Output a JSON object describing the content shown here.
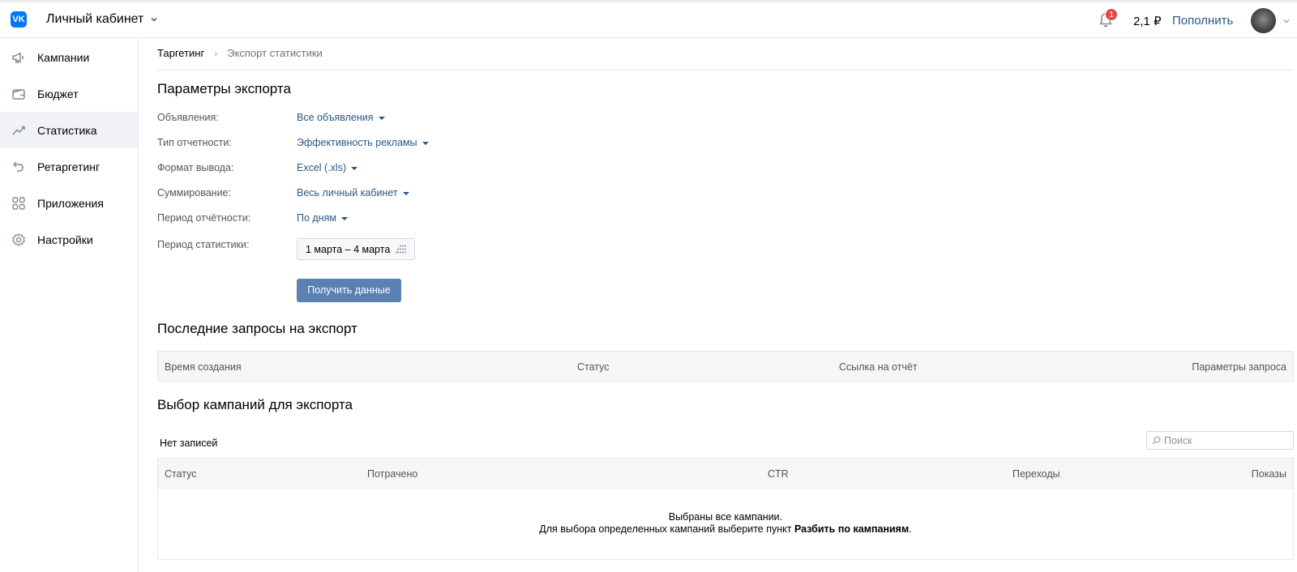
{
  "header": {
    "logo": "VK",
    "cabinet_label": "Личный кабинет",
    "notification_count": "1",
    "balance": "2,1 ₽",
    "topup_label": "Пополнить"
  },
  "sidebar": {
    "items": [
      {
        "label": "Кампании",
        "icon": "megaphone-icon"
      },
      {
        "label": "Бюджет",
        "icon": "wallet-icon"
      },
      {
        "label": "Статистика",
        "icon": "chart-icon",
        "active": true
      },
      {
        "label": "Ретаргетинг",
        "icon": "undo-arrow-icon"
      },
      {
        "label": "Приложения",
        "icon": "apps-grid-icon"
      },
      {
        "label": "Настройки",
        "icon": "gear-icon"
      }
    ]
  },
  "breadcrumb": {
    "root": "Таргетинг",
    "current": "Экспорт статистики"
  },
  "export_params": {
    "title": "Параметры экспорта",
    "rows": [
      {
        "label": "Объявления:",
        "value": "Все объявления"
      },
      {
        "label": "Тип отчетности:",
        "value": "Эффективность рекламы"
      },
      {
        "label": "Формат вывода:",
        "value": "Excel (.xls)"
      },
      {
        "label": "Суммирование:",
        "value": "Весь личный кабинет"
      },
      {
        "label": "Период отчётности:",
        "value": "По дням"
      }
    ],
    "period_label": "Период статистики:",
    "period_value": "1 марта – 4 марта",
    "submit_label": "Получить данные"
  },
  "recent_requests": {
    "title": "Последние запросы на экспорт",
    "columns": [
      "Время создания",
      "Статус",
      "Ссылка на отчёт",
      "Параметры запроса"
    ]
  },
  "campaigns": {
    "title": "Выбор кампаний для экспорта",
    "no_records": "Нет записей",
    "search_placeholder": "Поиск",
    "columns": [
      "Статус",
      "Потрачено",
      "CTR",
      "Переходы",
      "Показы"
    ],
    "empty_line1": "Выбраны все кампании.",
    "empty_line2_prefix": "Для выбора определенных кампаний выберите пункт",
    "empty_line2_link": "Разбить по кампаниям",
    "empty_line2_suffix": "."
  },
  "colors": {
    "accent_link": "#2a5885",
    "button": "#5b80b2",
    "logo": "#0077ff",
    "badge": "#e64646"
  }
}
